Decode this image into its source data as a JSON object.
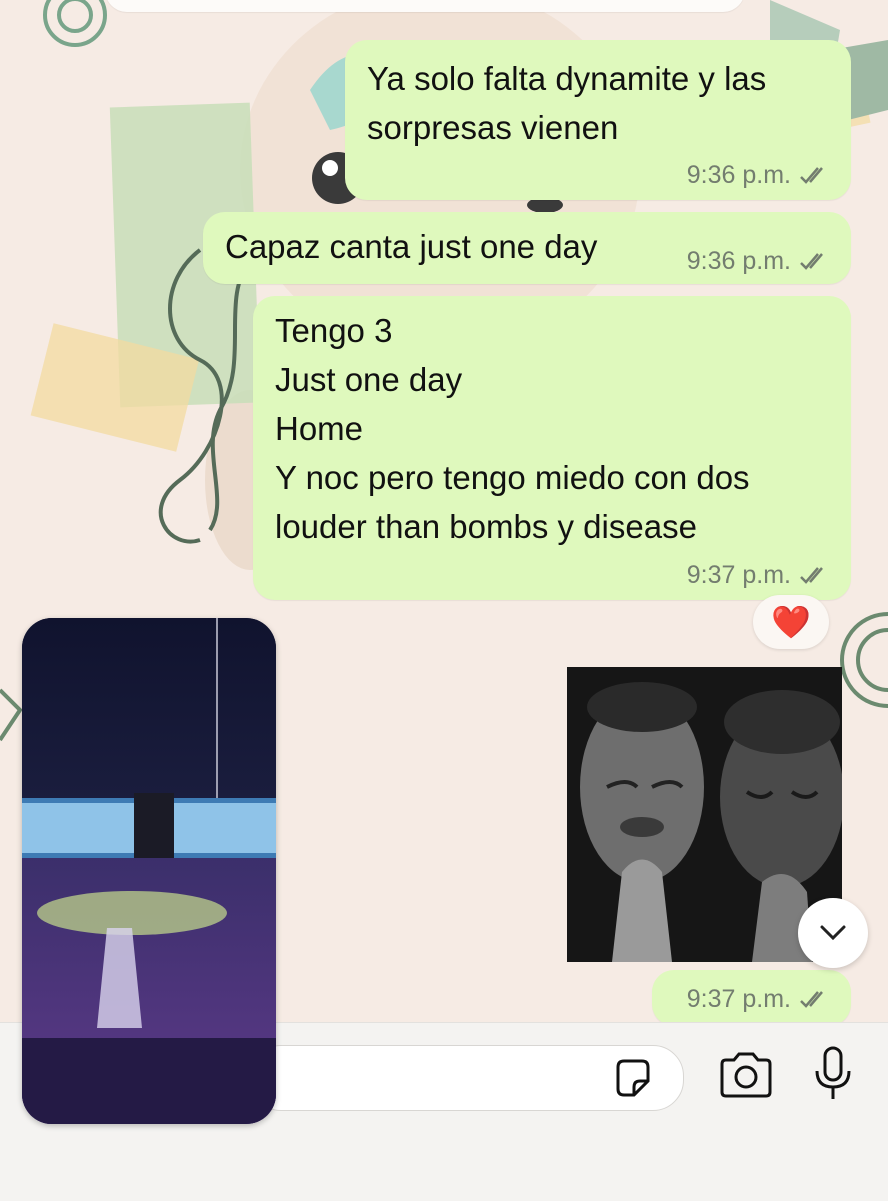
{
  "messages": [
    {
      "text": "Ya solo falta dynamite y las\nsorpresas vienen",
      "time": "9:36 p.m.",
      "status": "read"
    },
    {
      "text": "Capaz canta just one day",
      "time": "9:36 p.m.",
      "status": "read"
    },
    {
      "text": "Tengo 3\nJust one day\nHome\nY noc pero tengo miedo con dos\nlouder than bombs y disease",
      "time": "9:37 p.m.",
      "status": "read"
    },
    {
      "text": "",
      "time": "9:37 p.m.",
      "status": "read"
    }
  ],
  "reaction": {
    "emoji": "❤️"
  },
  "media": {
    "concert_video": {
      "description_icon": "concert-video-thumbnail"
    },
    "image": {
      "description_icon": "praying-men-photo"
    }
  },
  "input": {
    "placeholder": ""
  },
  "icons": {
    "sticker": "sticker-icon",
    "camera": "camera-icon",
    "mic": "microphone-icon",
    "scroll_down": "chevron-down-icon"
  },
  "colors": {
    "bubble_out": "#dff9bd",
    "background": "#f6ebe4",
    "tick_gray": "#737d6f",
    "heart": "#e11d2a"
  }
}
